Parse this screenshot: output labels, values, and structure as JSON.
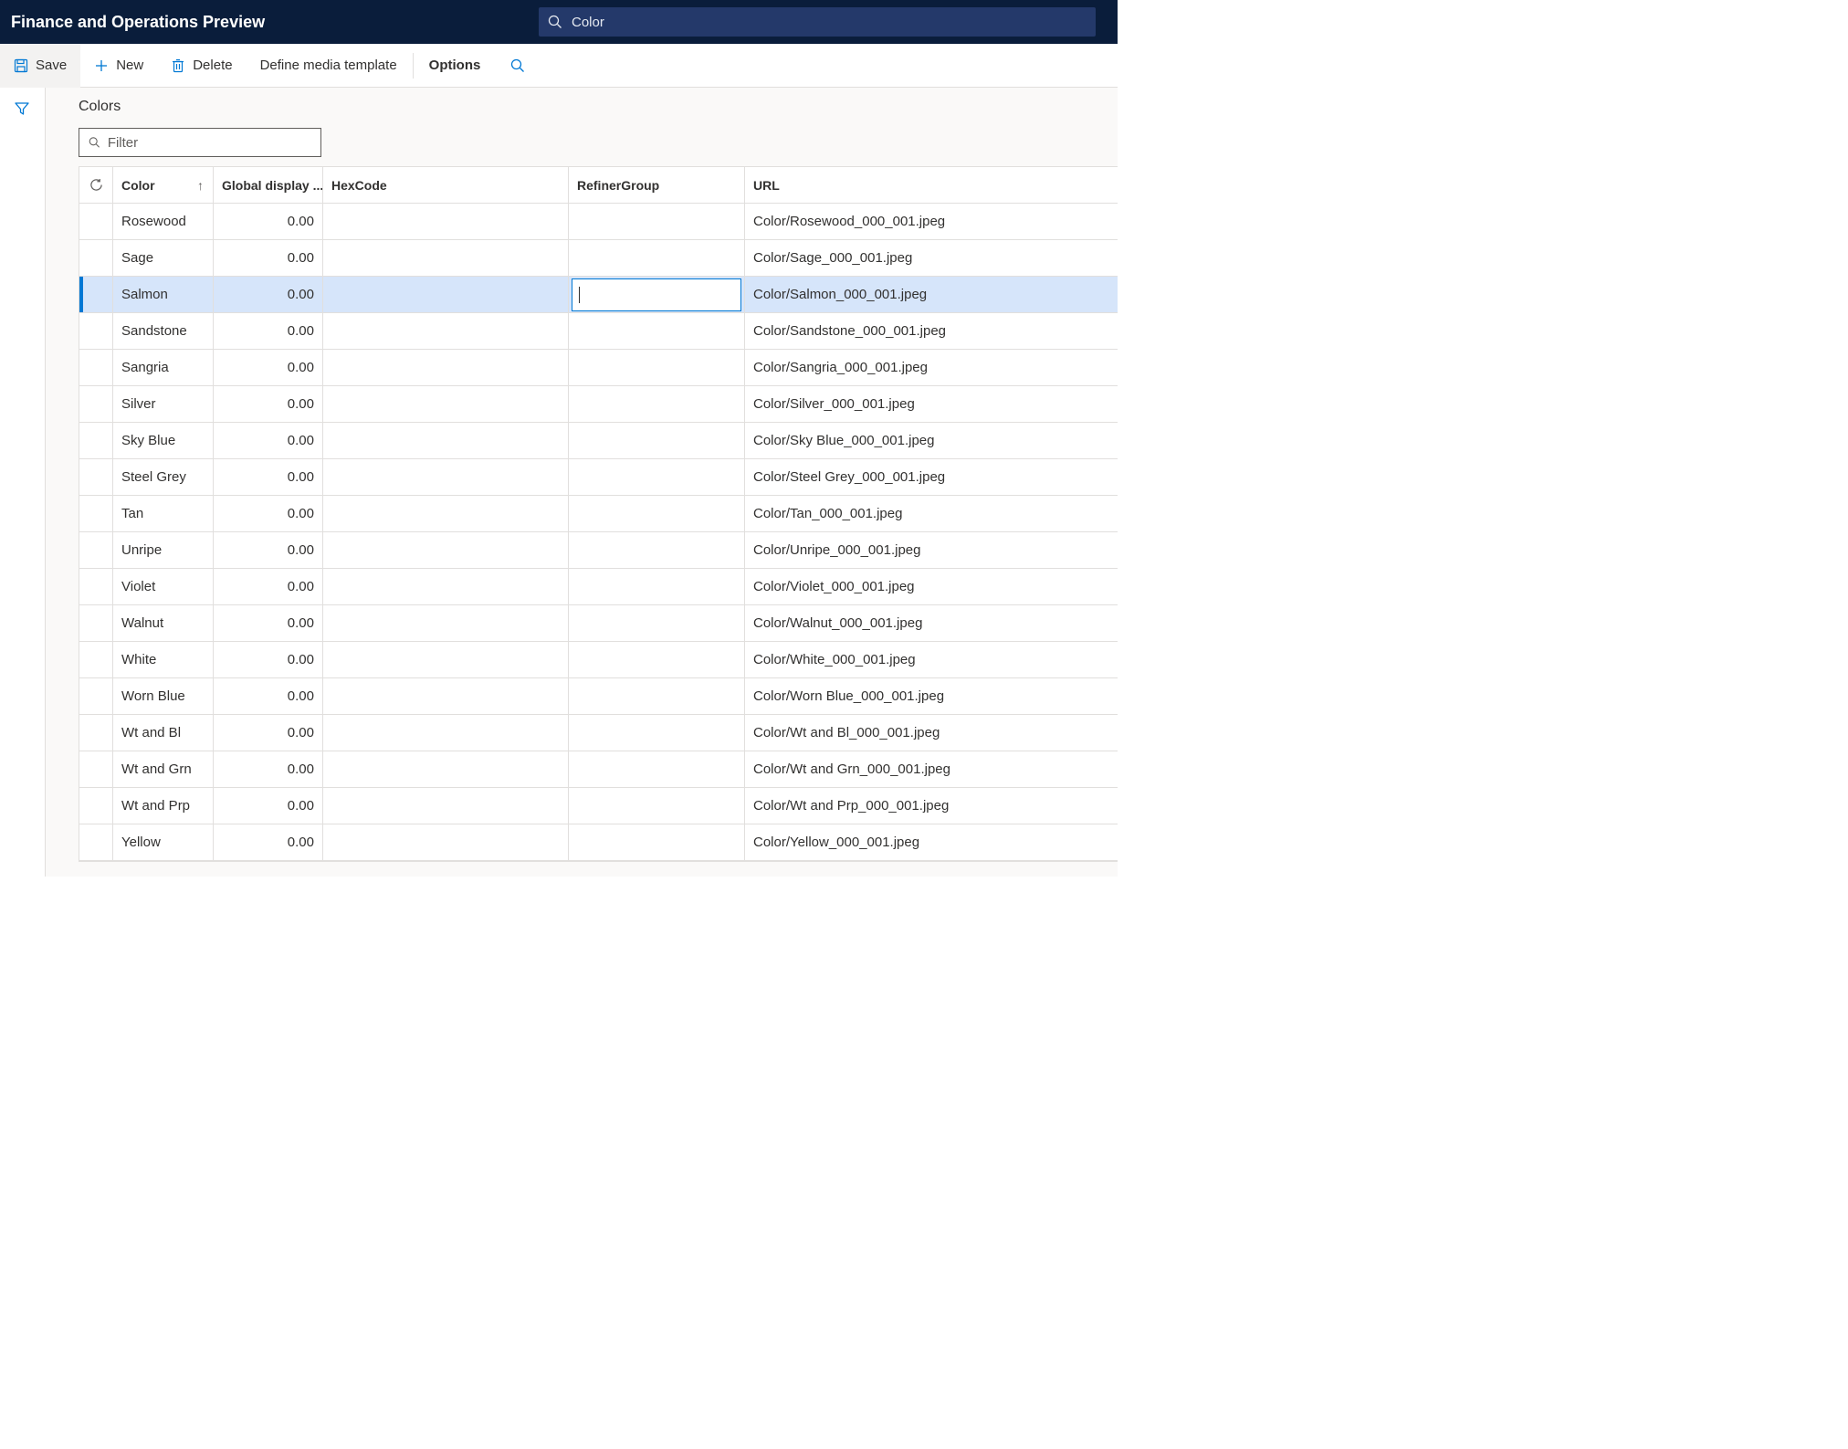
{
  "header": {
    "app_title": "Finance and Operations Preview",
    "search_value": "Color"
  },
  "actions": {
    "save": "Save",
    "new": "New",
    "delete": "Delete",
    "define_media": "Define media template",
    "options": "Options"
  },
  "page": {
    "heading": "Colors",
    "filter_placeholder": "Filter"
  },
  "grid": {
    "columns": {
      "color": "Color",
      "display_order": "Global display ...",
      "hexcode": "HexCode",
      "refiner_group": "RefinerGroup",
      "url": "URL"
    },
    "rows": [
      {
        "color": "Rosewood",
        "display": "0.00",
        "hex": "",
        "refiner": "",
        "url": "Color/Rosewood_000_001.jpeg",
        "selected": false
      },
      {
        "color": "Sage",
        "display": "0.00",
        "hex": "",
        "refiner": "",
        "url": "Color/Sage_000_001.jpeg",
        "selected": false
      },
      {
        "color": "Salmon",
        "display": "0.00",
        "hex": "",
        "refiner": "",
        "url": "Color/Salmon_000_001.jpeg",
        "selected": true
      },
      {
        "color": "Sandstone",
        "display": "0.00",
        "hex": "",
        "refiner": "",
        "url": "Color/Sandstone_000_001.jpeg",
        "selected": false
      },
      {
        "color": "Sangria",
        "display": "0.00",
        "hex": "",
        "refiner": "",
        "url": "Color/Sangria_000_001.jpeg",
        "selected": false
      },
      {
        "color": "Silver",
        "display": "0.00",
        "hex": "",
        "refiner": "",
        "url": "Color/Silver_000_001.jpeg",
        "selected": false
      },
      {
        "color": "Sky Blue",
        "display": "0.00",
        "hex": "",
        "refiner": "",
        "url": "Color/Sky Blue_000_001.jpeg",
        "selected": false
      },
      {
        "color": "Steel Grey",
        "display": "0.00",
        "hex": "",
        "refiner": "",
        "url": "Color/Steel Grey_000_001.jpeg",
        "selected": false
      },
      {
        "color": "Tan",
        "display": "0.00",
        "hex": "",
        "refiner": "",
        "url": "Color/Tan_000_001.jpeg",
        "selected": false
      },
      {
        "color": "Unripe",
        "display": "0.00",
        "hex": "",
        "refiner": "",
        "url": "Color/Unripe_000_001.jpeg",
        "selected": false
      },
      {
        "color": "Violet",
        "display": "0.00",
        "hex": "",
        "refiner": "",
        "url": "Color/Violet_000_001.jpeg",
        "selected": false
      },
      {
        "color": "Walnut",
        "display": "0.00",
        "hex": "",
        "refiner": "",
        "url": "Color/Walnut_000_001.jpeg",
        "selected": false
      },
      {
        "color": "White",
        "display": "0.00",
        "hex": "",
        "refiner": "",
        "url": "Color/White_000_001.jpeg",
        "selected": false
      },
      {
        "color": "Worn Blue",
        "display": "0.00",
        "hex": "",
        "refiner": "",
        "url": "Color/Worn Blue_000_001.jpeg",
        "selected": false
      },
      {
        "color": "Wt and Bl",
        "display": "0.00",
        "hex": "",
        "refiner": "",
        "url": "Color/Wt and Bl_000_001.jpeg",
        "selected": false
      },
      {
        "color": "Wt and Grn",
        "display": "0.00",
        "hex": "",
        "refiner": "",
        "url": "Color/Wt and Grn_000_001.jpeg",
        "selected": false
      },
      {
        "color": "Wt and Prp",
        "display": "0.00",
        "hex": "",
        "refiner": "",
        "url": "Color/Wt and Prp_000_001.jpeg",
        "selected": false
      },
      {
        "color": "Yellow",
        "display": "0.00",
        "hex": "",
        "refiner": "",
        "url": "Color/Yellow_000_001.jpeg",
        "selected": false
      }
    ]
  }
}
